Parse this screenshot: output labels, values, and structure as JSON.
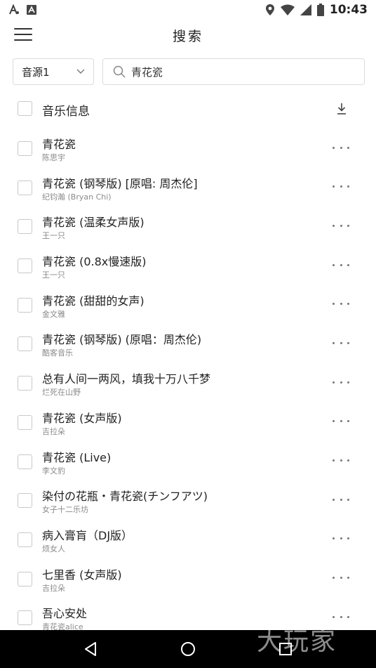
{
  "status_bar": {
    "time": "10:43",
    "left_icons": [
      "accessibility-icon",
      "a-notification-icon"
    ],
    "right_icons": [
      "location-icon",
      "wifi-icon",
      "signal-icon",
      "battery-icon"
    ]
  },
  "header": {
    "title": "搜索"
  },
  "search": {
    "source_value": "音源1",
    "query": "青花瓷"
  },
  "list_header": {
    "title": "音乐信息"
  },
  "songs": [
    {
      "title": "青花瓷",
      "artist": "陈思宇"
    },
    {
      "title": "青花瓷 (钢琴版) [原唱: 周杰伦]",
      "artist": "纪钧瀚 (Bryan Chi)"
    },
    {
      "title": "青花瓷 (温柔女声版)",
      "artist": "王一只"
    },
    {
      "title": "青花瓷 (0.8x慢速版)",
      "artist": "王一只"
    },
    {
      "title": "青花瓷 (甜甜的女声)",
      "artist": "金文雅"
    },
    {
      "title": "青花瓷 (钢琴版) (原唱：周杰伦)",
      "artist": "酷客音乐"
    },
    {
      "title": "总有人间一两风，填我十万八千梦",
      "artist": "烂死在山野"
    },
    {
      "title": "青花瓷 (女声版)",
      "artist": "吉拉朵"
    },
    {
      "title": "青花瓷 (Live)",
      "artist": "李文豹"
    },
    {
      "title": "染付の花瓶・青花瓷(チンフアツ)",
      "artist": "女子十二乐坊"
    },
    {
      "title": "病入膏肓（DJ版）",
      "artist": "烦女人"
    },
    {
      "title": "七里香 (女声版)",
      "artist": "吉拉朵"
    },
    {
      "title": "吾心安处",
      "artist": "青花瓷alice"
    }
  ],
  "watermark": "大玩家",
  "colors": {
    "background": "#ffffff",
    "text_primary": "#222222",
    "text_secondary": "#8a8a8a",
    "border": "#dcdcdc",
    "nav_bar": "#000000"
  }
}
